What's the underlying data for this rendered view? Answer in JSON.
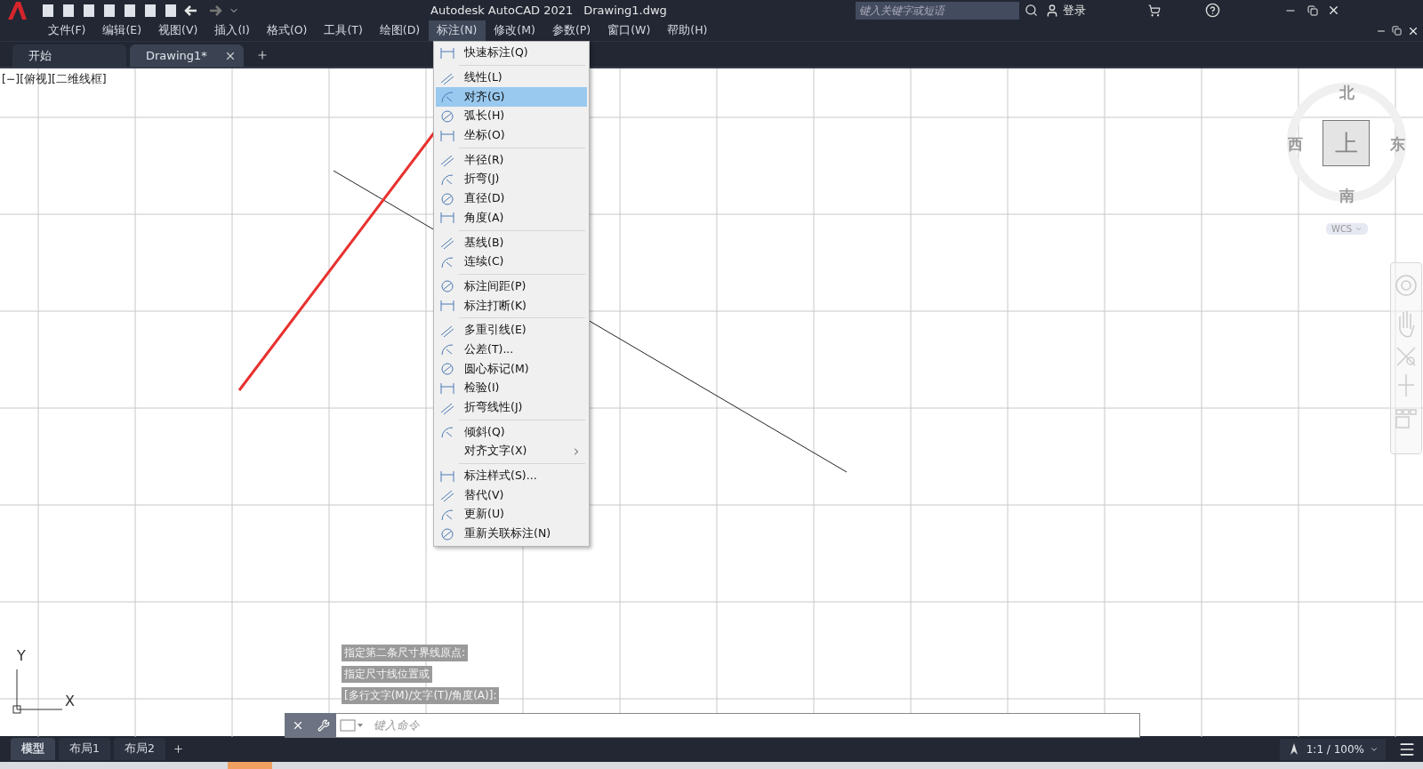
{
  "window": {
    "title": "Autodesk AutoCAD 2021",
    "document": "Drawing1.dwg"
  },
  "search": {
    "placeholder": "键入关键字或短语"
  },
  "account": {
    "label": "登录"
  },
  "menus": [
    {
      "label": "文件(F)",
      "selected": false
    },
    {
      "label": "编辑(E)",
      "selected": false
    },
    {
      "label": "视图(V)",
      "selected": false
    },
    {
      "label": "插入(I)",
      "selected": false
    },
    {
      "label": "格式(O)",
      "selected": false
    },
    {
      "label": "工具(T)",
      "selected": false
    },
    {
      "label": "绘图(D)",
      "selected": false
    },
    {
      "label": "标注(N)",
      "selected": true
    },
    {
      "label": "修改(M)",
      "selected": false
    },
    {
      "label": "参数(P)",
      "selected": false
    },
    {
      "label": "窗口(W)",
      "selected": false
    },
    {
      "label": "帮助(H)",
      "selected": false
    }
  ],
  "tabs": [
    {
      "label": "开始",
      "selected": false,
      "closable": false
    },
    {
      "label": "Drawing1*",
      "selected": true,
      "closable": true
    }
  ],
  "viewport_label": "[−][俯视][二维线框]",
  "dimension_menu": {
    "groups": [
      [
        {
          "label": "快速标注(Q)",
          "kind": "command",
          "selected": false
        }
      ],
      [
        {
          "label": "线性(L)",
          "kind": "command",
          "selected": false
        },
        {
          "label": "对齐(G)",
          "kind": "command",
          "selected": true
        },
        {
          "label": "弧长(H)",
          "kind": "command",
          "selected": false
        },
        {
          "label": "坐标(O)",
          "kind": "command",
          "selected": false
        }
      ],
      [
        {
          "label": "半径(R)",
          "kind": "command",
          "selected": false
        },
        {
          "label": "折弯(J)",
          "kind": "command",
          "selected": false
        },
        {
          "label": "直径(D)",
          "kind": "command",
          "selected": false
        },
        {
          "label": "角度(A)",
          "kind": "command",
          "selected": false
        }
      ],
      [
        {
          "label": "基线(B)",
          "kind": "command",
          "selected": false
        },
        {
          "label": "连续(C)",
          "kind": "command",
          "selected": false
        }
      ],
      [
        {
          "label": "标注间距(P)",
          "kind": "command",
          "selected": false
        },
        {
          "label": "标注打断(K)",
          "kind": "command",
          "selected": false
        }
      ],
      [
        {
          "label": "多重引线(E)",
          "kind": "command",
          "selected": false
        },
        {
          "label": "公差(T)...",
          "kind": "command",
          "selected": false
        },
        {
          "label": "圆心标记(M)",
          "kind": "command",
          "selected": false
        },
        {
          "label": "检验(I)",
          "kind": "command",
          "selected": false
        },
        {
          "label": "折弯线性(J)",
          "kind": "command",
          "selected": false
        }
      ],
      [
        {
          "label": "倾斜(Q)",
          "kind": "command",
          "selected": false
        },
        {
          "label": "对齐文字(X)",
          "kind": "submenu",
          "selected": false
        }
      ],
      [
        {
          "label": "标注样式(S)...",
          "kind": "command",
          "selected": false
        },
        {
          "label": "替代(V)",
          "kind": "command",
          "selected": false
        },
        {
          "label": "更新(U)",
          "kind": "command",
          "selected": false
        },
        {
          "label": "重新关联标注(N)",
          "kind": "command",
          "selected": false
        }
      ]
    ]
  },
  "viewcube": {
    "north": "北",
    "south": "南",
    "east": "东",
    "west": "西",
    "face": "上",
    "ucs": "WCS"
  },
  "command_history": [
    "指定第二条尺寸界线原点:",
    "指定尺寸线位置或",
    "[多行文字(M)/文字(T)/角度(A)]:"
  ],
  "command_line": {
    "placeholder": "键入命令"
  },
  "ucs_icon": {
    "x": "X",
    "y": "Y"
  },
  "layout_tabs": [
    {
      "label": "模型",
      "selected": true
    },
    {
      "label": "布局1",
      "selected": false
    },
    {
      "label": "布局2",
      "selected": false
    }
  ],
  "status": {
    "scale": "1:1 / 100%"
  }
}
